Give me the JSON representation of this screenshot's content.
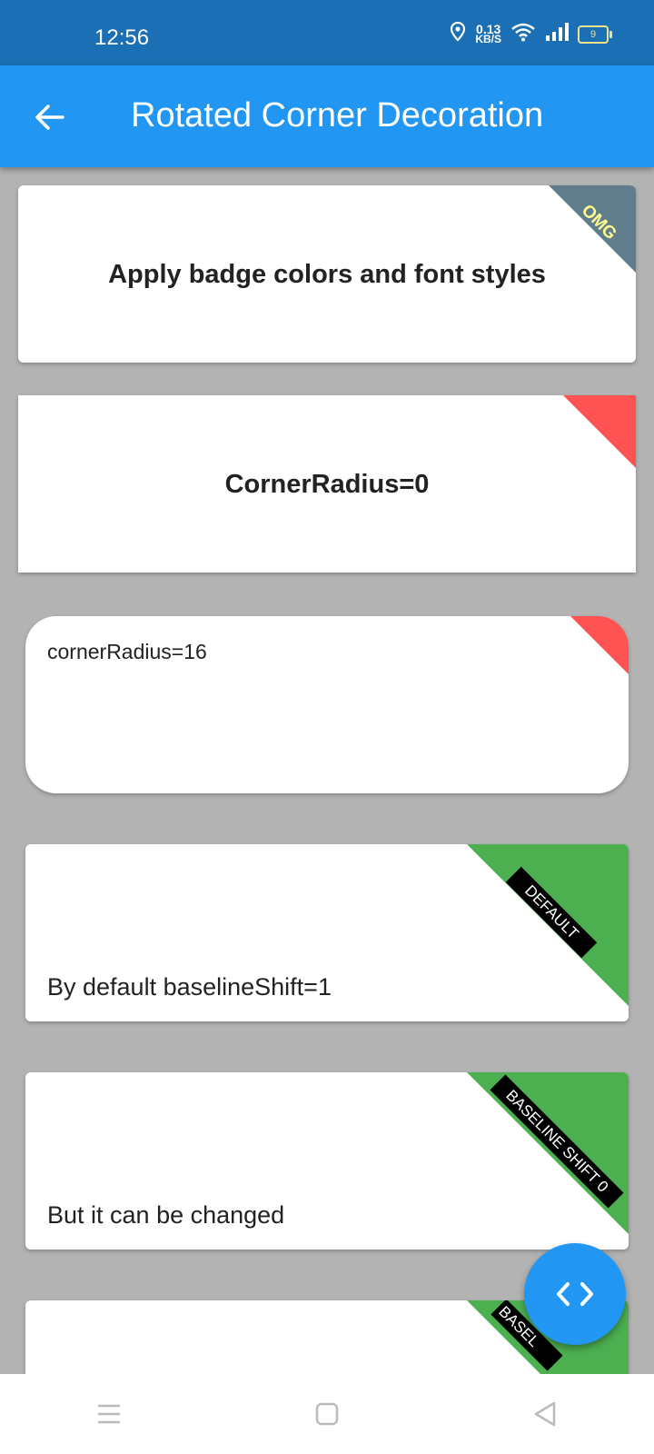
{
  "status": {
    "time": "12:56",
    "net_speed_value": "0.13",
    "net_speed_unit": "KB/S",
    "battery": "9"
  },
  "appbar": {
    "title": "Rotated Corner Decoration"
  },
  "cards": [
    {
      "text": "Apply badge colors and font styles",
      "badge_label": "OMG",
      "badge_color": "#607d8b",
      "badge_text_color": "#ffff8d"
    },
    {
      "text": "CornerRadius=0",
      "badge_color": "#ff5252"
    },
    {
      "text": "cornerRadius=16",
      "badge_color": "#ff5252"
    },
    {
      "text": "By default baselineShift=1",
      "badge_label": "DEFAULT",
      "badge_color": "#4caf50"
    },
    {
      "text": "But it can be changed",
      "badge_label": "BASELINE SHIFT 0",
      "badge_color": "#4caf50"
    },
    {
      "badge_label": "BASEL",
      "badge_color": "#4caf50"
    }
  ],
  "fab": {
    "icon": "code-icon"
  },
  "navbar": {
    "items": [
      "menu-icon",
      "home-square-icon",
      "back-triangle-icon"
    ]
  }
}
